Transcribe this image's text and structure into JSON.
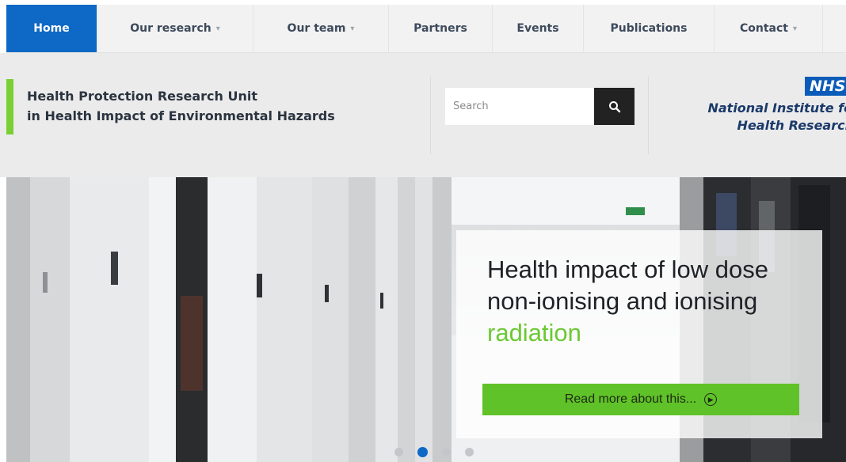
{
  "nav": {
    "items": [
      {
        "label": "Home",
        "active": true,
        "has_dropdown": false
      },
      {
        "label": "Our research",
        "active": false,
        "has_dropdown": true
      },
      {
        "label": "Our team",
        "active": false,
        "has_dropdown": true
      },
      {
        "label": "Partners",
        "active": false,
        "has_dropdown": false
      },
      {
        "label": "Events",
        "active": false,
        "has_dropdown": false
      },
      {
        "label": "Publications",
        "active": false,
        "has_dropdown": false
      },
      {
        "label": "Contact",
        "active": false,
        "has_dropdown": true
      }
    ],
    "caret": "▾"
  },
  "header": {
    "title_line1": "Health Protection Research Unit",
    "title_line2": "in Health Impact of Environmental Hazards",
    "accent_color": "#79cf34"
  },
  "search": {
    "placeholder": "Search",
    "value": "",
    "button_icon": "search-icon"
  },
  "logo": {
    "badge": "NHS",
    "line1": "National Institute for",
    "line2": "Health Research"
  },
  "hero": {
    "title_main": "Health impact of low dose non-ionising and ionising",
    "title_highlight": "radiation",
    "cta_label": "Read more about this...",
    "cta_icon": "circle-arrow-right-icon",
    "slides": 4,
    "active_slide": 2
  },
  "colors": {
    "primary_blue": "#0e68c5",
    "cta_green": "#5fc228",
    "highlight_green": "#6cc832"
  }
}
